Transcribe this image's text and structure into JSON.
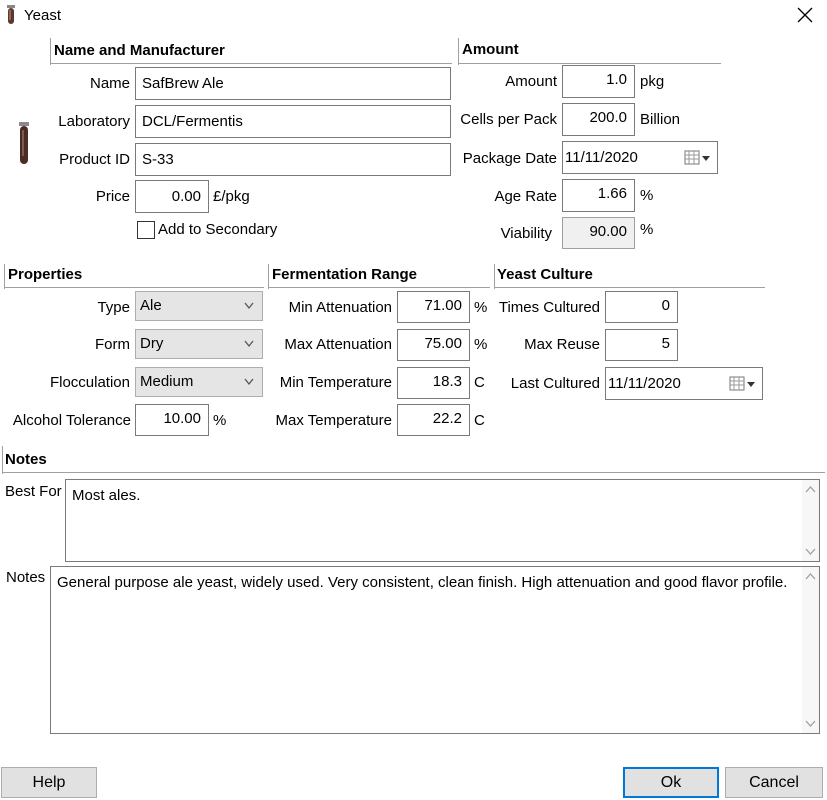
{
  "window": {
    "title": "Yeast",
    "icon": "test-tube-icon",
    "close_icon": "close-icon"
  },
  "name_mfr": {
    "heading": "Name and Manufacturer",
    "name_label": "Name",
    "name_value": "SafBrew Ale",
    "lab_label": "Laboratory",
    "lab_value": "DCL/Fermentis",
    "pid_label": "Product ID",
    "pid_value": "S-33",
    "price_label": "Price",
    "price_value": "0.00",
    "price_unit": "£/pkg",
    "secondary_label": "Add to Secondary",
    "secondary_checked": false
  },
  "amount": {
    "heading": "Amount",
    "amount_label": "Amount",
    "amount_value": "1.0",
    "amount_unit": "pkg",
    "cells_label": "Cells per Pack",
    "cells_value": "200.0",
    "cells_unit": "Billion",
    "pkgdate_label": "Package Date",
    "pkgdate_value": "11/11/2020",
    "agerate_label": "Age Rate",
    "agerate_value": "1.66",
    "agerate_unit": "%",
    "viability_label": "Viability",
    "viability_value": "90.00",
    "viability_unit": "%"
  },
  "properties": {
    "heading": "Properties",
    "type_label": "Type",
    "type_value": "Ale",
    "form_label": "Form",
    "form_value": "Dry",
    "floc_label": "Flocculation",
    "floc_value": "Medium",
    "alc_label": "Alcohol Tolerance",
    "alc_value": "10.00",
    "alc_unit": "%"
  },
  "fermentation": {
    "heading": "Fermentation Range",
    "minatt_label": "Min Attenuation",
    "minatt_value": "71.00",
    "minatt_unit": "%",
    "maxatt_label": "Max Attenuation",
    "maxatt_value": "75.00",
    "maxatt_unit": "%",
    "mintemp_label": "Min Temperature",
    "mintemp_value": "18.3",
    "mintemp_unit": "C",
    "maxtemp_label": "Max Temperature",
    "maxtemp_value": "22.2",
    "maxtemp_unit": "C"
  },
  "culture": {
    "heading": "Yeast Culture",
    "times_label": "Times Cultured",
    "times_value": "0",
    "reuse_label": "Max Reuse",
    "reuse_value": "5",
    "last_label": "Last Cultured",
    "last_value": "11/11/2020"
  },
  "notes": {
    "heading": "Notes",
    "bestfor_label": "Best For",
    "bestfor_value": "Most ales.",
    "notes_label": "Notes",
    "notes_value": "General purpose ale yeast, widely used.  Very consistent, clean finish. High attenuation and good flavor profile."
  },
  "buttons": {
    "help": "Help",
    "ok": "Ok",
    "cancel": "Cancel"
  },
  "colors": {
    "accent": "#0078d7",
    "yeast_tube": "#4a2c22"
  }
}
